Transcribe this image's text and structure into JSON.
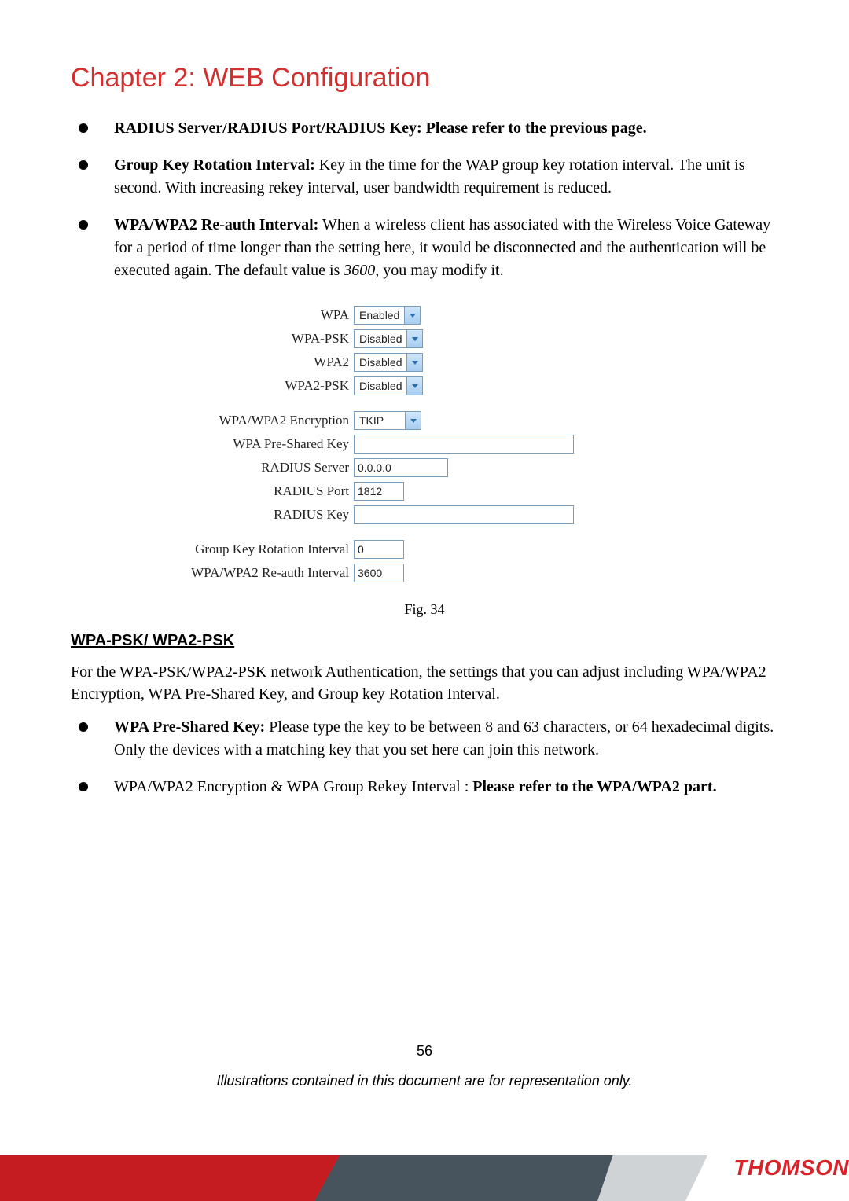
{
  "header": {
    "chapter_title": "Chapter 2: WEB Configuration"
  },
  "bullets": {
    "b1_bold": "RADIUS Server/RADIUS Port/RADIUS Key: Please refer to the previous page.",
    "b2_bold": "Group Key Rotation Interval:",
    "b2_rest": " Key in the time for the WAP group key rotation interval. The unit is second. With increasing rekey interval, user bandwidth requirement is reduced.",
    "b3_bold": "WPA/WPA2 Re-auth Interval:",
    "b3_rest_a": " When a wireless client has associated with the Wireless Voice Gateway for a period of time longer than the setting here, it would be disconnected and the authentication will be executed again. The default value is ",
    "b3_italic": "3600",
    "b3_rest_b": ", you may modify it."
  },
  "settings": {
    "wpa_label": "WPA",
    "wpa_value": "Enabled",
    "wpapsk_label": "WPA-PSK",
    "wpapsk_value": "Disabled",
    "wpa2_label": "WPA2",
    "wpa2_value": "Disabled",
    "wpa2psk_label": "WPA2-PSK",
    "wpa2psk_value": "Disabled",
    "enc_label": "WPA/WPA2 Encryption",
    "enc_value": "TKIP",
    "psk_label": "WPA Pre-Shared Key",
    "psk_value": "",
    "radius_server_label": "RADIUS Server",
    "radius_server_value": "0.0.0.0",
    "radius_port_label": "RADIUS Port",
    "radius_port_value": "1812",
    "radius_key_label": "RADIUS Key",
    "radius_key_value": "",
    "group_rot_label": "Group Key Rotation Interval",
    "group_rot_value": "0",
    "reauth_label": "WPA/WPA2 Re-auth Interval",
    "reauth_value": "3600"
  },
  "fig_caption": "Fig. 34",
  "section_heading": "WPA-PSK/ WPA2-PSK",
  "section_para": "For the WPA-PSK/WPA2-PSK network Authentication, the settings that you can adjust including WPA/WPA2 Encryption, WPA Pre-Shared Key, and Group key Rotation Interval.",
  "bullets2": {
    "b1_bold": "WPA Pre-Shared Key:",
    "b1_rest": " Please type the key to be between 8 and 63 characters, or 64 hexadecimal digits. Only the devices with a matching key that you set here can join this network.",
    "b2_a": "WPA/WPA2 Encryption & WPA Group Rekey Interval : ",
    "b2_bold": "Please refer to the WPA/WPA2 part."
  },
  "footer": {
    "page_number": "56",
    "disclaimer": "Illustrations contained in this document are for representation only.",
    "brand": "THOMSON"
  }
}
